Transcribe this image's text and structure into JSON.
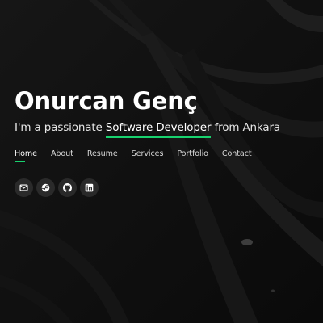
{
  "hero": {
    "name": "Onurcan Genç",
    "tagline_prefix": "I'm a passionate",
    "tagline_highlight": "Software Developer",
    "tagline_suffix": "from Ankara"
  },
  "nav": {
    "items": [
      {
        "label": "Home",
        "active": true
      },
      {
        "label": "About"
      },
      {
        "label": "Resume"
      },
      {
        "label": "Services"
      },
      {
        "label": "Portfolio"
      },
      {
        "label": "Contact"
      }
    ]
  },
  "social": {
    "icons": [
      "mail-icon",
      "steam-icon",
      "github-icon",
      "linkedin-icon"
    ]
  },
  "colors": {
    "accent": "#18d26e",
    "background": "#0e0e0e"
  }
}
